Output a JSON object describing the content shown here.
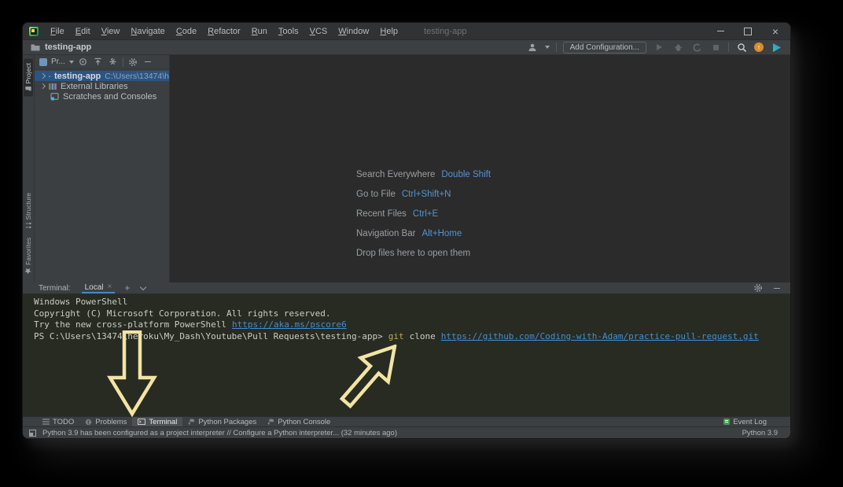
{
  "window": {
    "title": "testing-app"
  },
  "menu": {
    "items": [
      "File",
      "Edit",
      "View",
      "Navigate",
      "Code",
      "Refactor",
      "Run",
      "Tools",
      "VCS",
      "Window",
      "Help"
    ]
  },
  "toolbar": {
    "breadcrumb": "testing-app",
    "add_configuration": "Add Configuration..."
  },
  "stripe": {
    "project": "Project",
    "structure": "Structure",
    "favorites": "Favorites"
  },
  "project_panel": {
    "view_label": "Pr...",
    "tree": [
      {
        "label": "testing-app",
        "path": "C:\\Users\\13474\\h"
      },
      {
        "label": "External Libraries",
        "path": ""
      },
      {
        "label": "Scratches and Consoles",
        "path": ""
      }
    ]
  },
  "editor_shortcuts": [
    {
      "label": "Search Everywhere",
      "keys": "Double Shift"
    },
    {
      "label": "Go to File",
      "keys": "Ctrl+Shift+N"
    },
    {
      "label": "Recent Files",
      "keys": "Ctrl+E"
    },
    {
      "label": "Navigation Bar",
      "keys": "Alt+Home"
    },
    {
      "label": "Drop files here to open them",
      "keys": ""
    }
  ],
  "terminal": {
    "panel_title": "Terminal:",
    "tab_label": "Local",
    "close_glyph": "×",
    "output": {
      "line1": "Windows PowerShell",
      "line2": "Copyright (C) Microsoft Corporation. All rights reserved.",
      "line3_text": "Try the new cross-platform PowerShell",
      "line3_link": "https://aka.ms/pscore6",
      "line4_prompt": "PS C:\\Users\\13474\\heroku\\My_Dash\\Youtube\\Pull Requests\\testing-app>",
      "line4_git": "git",
      "line4_clone": "clone",
      "line4_url": "https://github.com/Coding-with-Adam/practice-pull-request.git"
    }
  },
  "bottom_bar": {
    "tabs": [
      {
        "label": "TODO"
      },
      {
        "label": "Problems"
      },
      {
        "label": "Terminal"
      },
      {
        "label": "Python Packages"
      },
      {
        "label": "Python Console"
      }
    ],
    "event_log": "Event Log"
  },
  "status_bar": {
    "message": "Python 3.9 has been configured as a project interpreter // Configure a Python interpreter... (32 minutes ago)",
    "interpreter": "Python 3.9"
  },
  "colors": {
    "panel_bg": "#3c3f41",
    "editor_bg": "#2b2b2b",
    "terminal_bg": "#282b22",
    "selection_blue": "#2c5483",
    "link_blue": "#3f8fd6",
    "shortcut_key_blue": "#5394d6",
    "git_command_yellow": "#c4a747",
    "annotation_arrow_cream": "#f2e4a4",
    "event_log_green": "#499c54",
    "update_orange": "#d98e2a"
  }
}
